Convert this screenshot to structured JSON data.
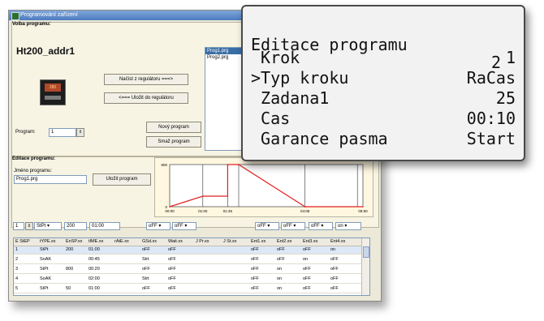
{
  "window": {
    "title": "Programování zařízení"
  },
  "program_select": {
    "section_label": "Volba programu:",
    "device_name": "Ht200_addr1",
    "device_display": "280",
    "load_button": "Načíst z regulátoru ===>",
    "save_button": "<=== Uložit do regulátoru",
    "new_button": "Nový program",
    "delete_button": "Smaž program",
    "program_label": "Program:",
    "program_value": "1",
    "files": [
      "Prog1.prg",
      "Prog2.prg"
    ]
  },
  "editor": {
    "section_label": "Editace programu:",
    "name_label": "Jméno programu:",
    "name_value": "Prog1.prg",
    "save_program_button": "Uložit program"
  },
  "chart_data": {
    "type": "line",
    "y_ticks": [
      "800",
      "0"
    ],
    "x_ticks": [
      "00:00",
      "01:00",
      "01:45",
      "04:05",
      "05:50"
    ],
    "x": [
      0,
      60,
      60,
      105,
      105,
      125,
      125,
      245,
      245,
      350
    ],
    "y": [
      0,
      200,
      200,
      200,
      800,
      800,
      800,
      0,
      0,
      0
    ],
    "ylim": [
      0,
      800
    ]
  },
  "controls": {
    "step": "1",
    "type": "StPt",
    "setpoint": "200",
    "time": "01:00",
    "gsd": "oFF",
    "wait": "oFF",
    "ent1": "oFF",
    "ent2": "oFF",
    "ent3": "oFF",
    "ent4": "on"
  },
  "table": {
    "headers": [
      "E StEP",
      "tYPE.xx",
      "EnSP.xx",
      "tIME.xx",
      "rAtE.xx",
      "GSd.xx",
      "Wait.xx",
      "J Pr.xx",
      "J St.xx",
      "Ent1.xx",
      "Ent2.xx",
      "Ent3.xx",
      "Ent4.xx"
    ],
    "rows": [
      [
        "1",
        "StPt",
        "200",
        "01:00",
        "",
        "oFF",
        "oFF",
        "",
        "",
        "oFF",
        "oFF",
        "oFF",
        "on"
      ],
      [
        "2",
        "SoAK",
        "",
        "00:45",
        "",
        "Strt",
        "oFF",
        "",
        "",
        "oFF",
        "oFF",
        "on",
        "oFF"
      ],
      [
        "3",
        "StPt",
        "800",
        "00:20",
        "",
        "oFF",
        "oFF",
        "",
        "",
        "oFF",
        "on",
        "oFF",
        "oFF"
      ],
      [
        "4",
        "SoAK",
        "",
        "02:00",
        "",
        "Strt",
        "oFF",
        "",
        "",
        "oFF",
        "on",
        "oFF",
        "oFF"
      ],
      [
        "5",
        "StPt",
        "50",
        "01:00",
        "",
        "oFF",
        "oFF",
        "",
        "",
        "oFF",
        "on",
        "oFF",
        "oFF"
      ]
    ]
  },
  "lcd": {
    "title": "Editace programu",
    "number": "2",
    "lines": [
      {
        "key": " Krok",
        "value": "1"
      },
      {
        "key": ">Typ kroku",
        "value": "RaCas"
      },
      {
        "key": " Zadana1",
        "value": "25"
      },
      {
        "key": " Cas",
        "value": "00:10"
      },
      {
        "key": " Garance pasma",
        "value": "Start"
      }
    ]
  }
}
